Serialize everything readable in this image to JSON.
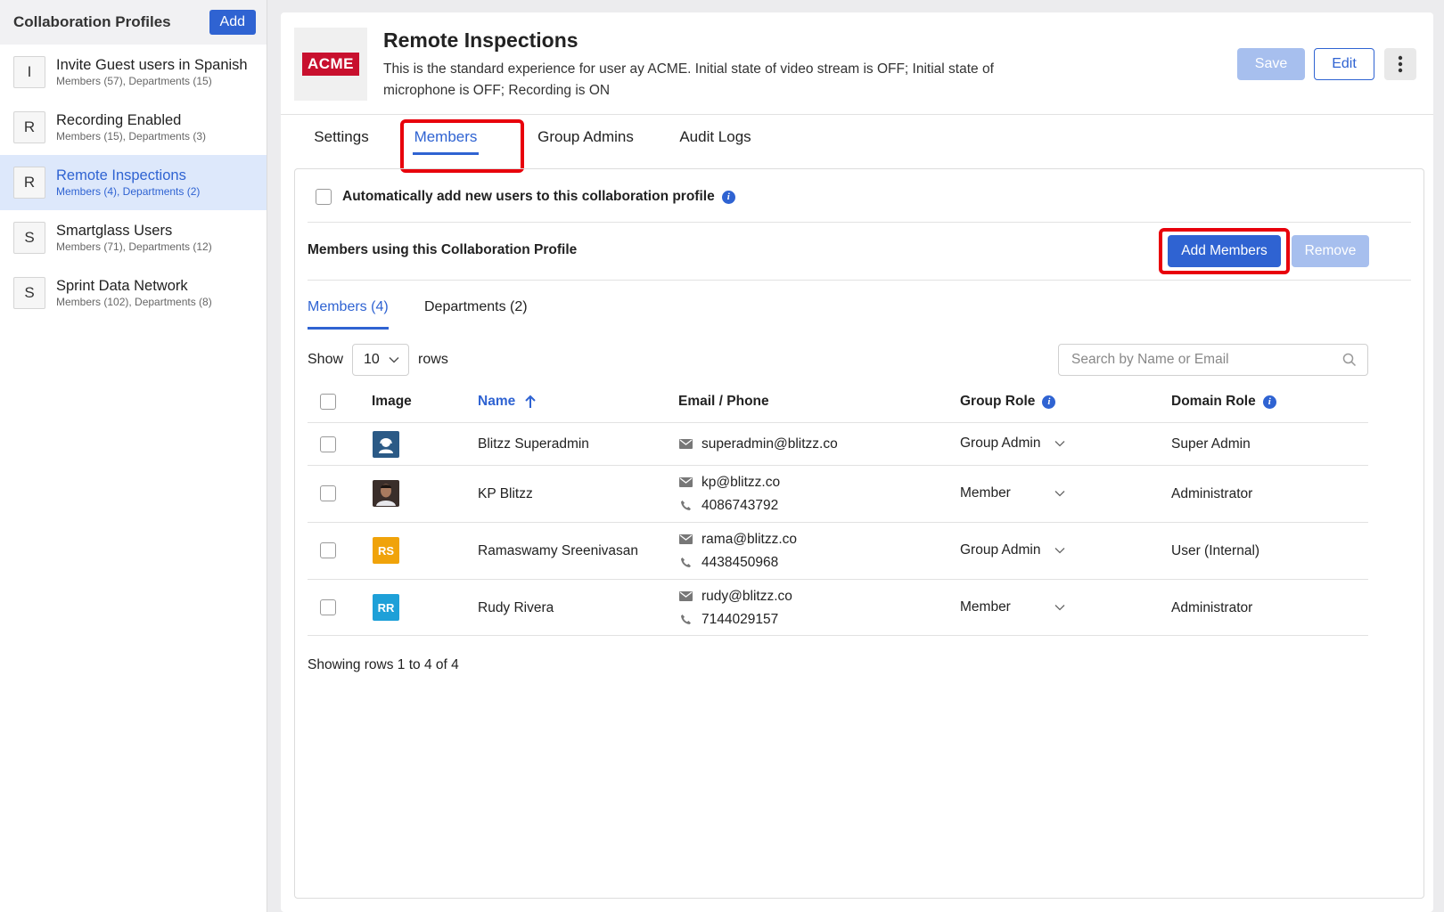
{
  "sidebar": {
    "title": "Collaboration Profiles",
    "add_label": "Add",
    "items": [
      {
        "letter": "I",
        "name": "Invite Guest users in Spanish",
        "sub": "Members (57), Departments (15)"
      },
      {
        "letter": "R",
        "name": "Recording Enabled",
        "sub": "Members (15), Departments (3)"
      },
      {
        "letter": "R",
        "name": "Remote Inspections",
        "sub": "Members (4), Departments (2)",
        "active": true
      },
      {
        "letter": "S",
        "name": "Smartglass Users",
        "sub": "Members (71), Departments (12)"
      },
      {
        "letter": "S",
        "name": "Sprint Data Network",
        "sub": "Members (102), Departments (8)"
      }
    ]
  },
  "header": {
    "logo_text": "ACME",
    "title": "Remote Inspections",
    "description": "This is the standard experience for user ay ACME. Initial state of video stream is OFF; Initial state of microphone is OFF; Recording is ON",
    "save_label": "Save",
    "edit_label": "Edit"
  },
  "tabs": [
    "Settings",
    "Members",
    "Group Admins",
    "Audit Logs"
  ],
  "active_tab": "Members",
  "members_panel": {
    "auto_add_label": "Automatically add new users to this collaboration profile",
    "section_title": "Members using this Collaboration Profile",
    "add_members_label": "Add Members",
    "remove_label": "Remove",
    "subtabs": [
      "Members (4)",
      "Departments (2)"
    ],
    "show_label": "Show",
    "rows_value": "10",
    "rows_label": "rows",
    "search_placeholder": "Search by Name or Email",
    "columns": {
      "image": "Image",
      "name": "Name",
      "email_phone": "Email / Phone",
      "group_role": "Group Role",
      "domain_role": "Domain Role"
    },
    "rows": [
      {
        "name": "Blitzz Superadmin",
        "email": "superadmin@blitzz.co",
        "phone": "",
        "group_role": "Group Admin",
        "domain_role": "Super Admin",
        "avatar": "icon",
        "avatar_color": "#2b5a86"
      },
      {
        "name": "KP Blitzz",
        "email": "kp@blitzz.co",
        "phone": "4086743792",
        "group_role": "Member",
        "domain_role": "Administrator",
        "avatar": "photo",
        "avatar_color": "#3a2e2a"
      },
      {
        "name": "Ramaswamy Sreenivasan",
        "email": "rama@blitzz.co",
        "phone": "4438450968",
        "group_role": "Group Admin",
        "domain_role": "User (Internal)",
        "avatar": "RS",
        "avatar_color": "#f0a30a"
      },
      {
        "name": "Rudy Rivera",
        "email": "rudy@blitzz.co",
        "phone": "7144029157",
        "group_role": "Member",
        "domain_role": "Administrator",
        "avatar": "RR",
        "avatar_color": "#1ea0d8"
      }
    ],
    "footer": "Showing rows 1 to 4 of 4"
  },
  "colors": {
    "accent": "#2f63d2",
    "highlight": "#e8000b",
    "disabled": "#a7bfee"
  }
}
